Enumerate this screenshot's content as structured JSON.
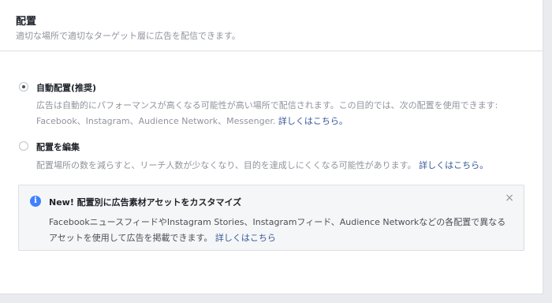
{
  "section": {
    "title": "配置",
    "subtitle": "適切な場所で適切なターゲット層に広告を配信できます。"
  },
  "options": [
    {
      "label": "自動配置(推奨)",
      "selected": true,
      "desc_line1": "広告は自動的にパフォーマンスが高くなる可能性が高い場所で配信されます。この目的では、次の配置を使用できます:",
      "desc_line2": "Facebook、Instagram、Audience Network、Messenger. ",
      "link": "詳しくはこちら。"
    },
    {
      "label": "配置を編集",
      "selected": false,
      "desc_line1": "配置場所の数を減らすと、リーチ人数が少なくなり、目的を達成しにくくなる可能性があります。 ",
      "link": "詳しくはこちら。"
    }
  ],
  "notice": {
    "icon": "info-icon",
    "title": "New! 配置別に広告素材アセットをカスタマイズ",
    "body": "FacebookニュースフィードやInstagram Stories、Instagramフィード、Audience Networkなどの各配置で異なるアセットを使用して広告を掲載できます。 ",
    "link": "詳しくはこちら",
    "close_symbol": "×"
  },
  "colors": {
    "link": "#365899",
    "info_blue": "#4080ff",
    "muted_text": "#90949c"
  }
}
